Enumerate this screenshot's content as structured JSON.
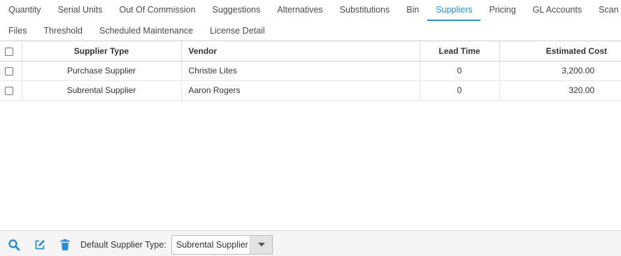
{
  "tabs": {
    "row1": [
      "Quantity",
      "Serial Units",
      "Out Of Commission",
      "Suggestions",
      "Alternatives",
      "Substitutions",
      "Bin",
      "Suppliers",
      "Pricing",
      "GL Accounts",
      "Scan Log"
    ],
    "row2": [
      "Files",
      "Threshold",
      "Scheduled Maintenance",
      "License Detail"
    ],
    "active": "Suppliers"
  },
  "table": {
    "headers": {
      "supplier_type": "Supplier Type",
      "vendor": "Vendor",
      "lead_time": "Lead Time",
      "estimated_cost": "Estimated Cost"
    },
    "rows": [
      {
        "supplier_type": "Purchase Supplier",
        "vendor": "Christie Lites",
        "lead_time": "0",
        "estimated_cost": "3,200.00"
      },
      {
        "supplier_type": "Subrental Supplier",
        "vendor": "Aaron Rogers",
        "lead_time": "0",
        "estimated_cost": "320.00"
      }
    ]
  },
  "footer": {
    "icons": [
      "search-icon",
      "edit-icon",
      "trash-icon"
    ],
    "default_supplier_label": "Default Supplier Type:",
    "default_supplier_value": "Subrental Supplier"
  },
  "colors": {
    "accent": "#2a8fd6",
    "footer_bg": "#f5f5f5"
  }
}
